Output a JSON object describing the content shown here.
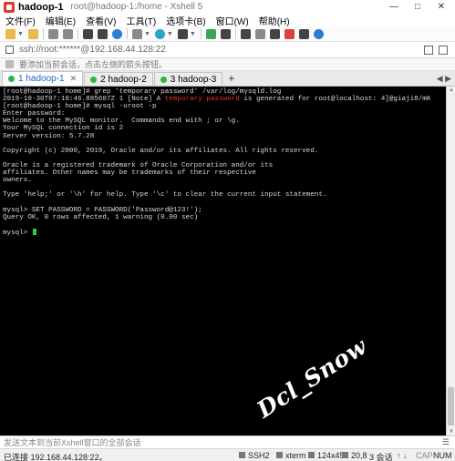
{
  "window": {
    "title": "hadoop-1",
    "subtitle": "root@hadoop-1:/home - Xshell 5",
    "controls": [
      "—",
      "□",
      "✕"
    ]
  },
  "menu": [
    "文件(F)",
    "编辑(E)",
    "查看(V)",
    "工具(T)",
    "选项卡(B)",
    "窗口(W)",
    "帮助(H)"
  ],
  "address": {
    "value": "ssh://root:******@192.168.44.128:22"
  },
  "hint": {
    "text": "要添加当前会话，点击左侧的箭头按钮。"
  },
  "tabs": [
    {
      "label": "1 hadoop-1",
      "active": true
    },
    {
      "label": "2 hadoop-2",
      "active": false
    },
    {
      "label": "3 hadoop-3",
      "active": false
    }
  ],
  "tab_add": "+",
  "terminal": {
    "lines": [
      "[root@hadoop-1 home]# grep 'temporary password' /var/log/mysqld.log",
      "RED_LINE",
      "[root@hadoop-1 home]# mysql -uroot -p",
      "Enter password:",
      "Welcome to the MySQL monitor.  Commands end with ; or \\g.",
      "Your MySQL connection id is 2",
      "Server version: 5.7.28",
      "",
      "Copyright (c) 2000, 2019, Oracle and/or its affiliates. All rights reserved.",
      "",
      "Oracle is a registered trademark of Oracle Corporation and/or its",
      "affiliates. Other names may be trademarks of their respective",
      "owners.",
      "",
      "Type 'help;' or '\\h' for help. Type '\\c' to clear the current input statement.",
      "",
      "mysql> SET PASSWORD = PASSWORD('Password@123!');",
      "Query OK, 0 rows affected, 1 warning (0.00 sec)",
      "",
      "PROMPT"
    ],
    "log_line": {
      "prefix": "2019-10-30T07:10:46.885607Z 1 [Note] A ",
      "highlight": "temporary password",
      "suffix": " is generated for root@localhost: 4]@giaji8/mK"
    },
    "prompt": "mysql> ",
    "watermark": "Dcl_Snow"
  },
  "compose": {
    "placeholder": "发送文本到当前Xshell窗口的全部会话"
  },
  "status": {
    "connection": "已连接 192.168.44.128:22。",
    "protocol": "SSH2",
    "term": "xterm",
    "size": "124x45",
    "cursor_pos": "20,8",
    "sessions": "3 会话",
    "caps": "CAP",
    "num": "NUM"
  }
}
